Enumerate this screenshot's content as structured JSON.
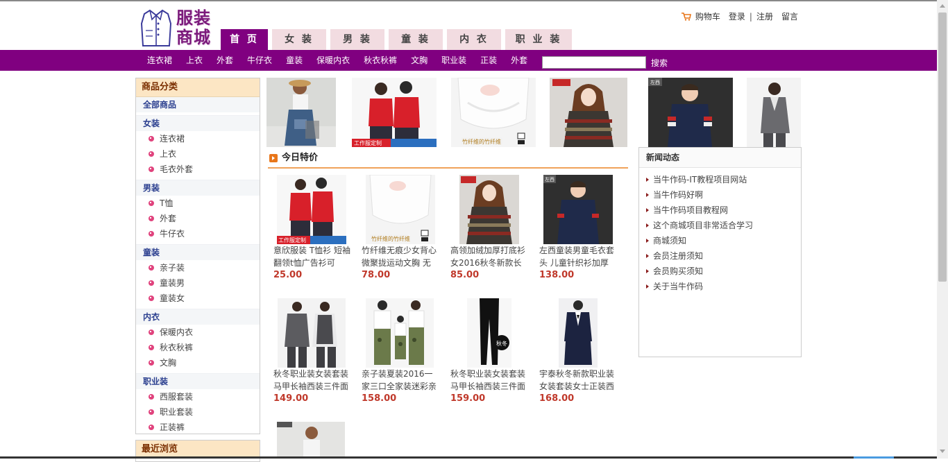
{
  "header": {
    "brand": "服装商城",
    "cart_label": "购物车",
    "links": [
      "登录",
      "注册",
      "留言"
    ],
    "separator": "|"
  },
  "nav_tabs": [
    {
      "label": "首 页",
      "active": true
    },
    {
      "label": "女 装",
      "active": false
    },
    {
      "label": "男 装",
      "active": false
    },
    {
      "label": "童 装",
      "active": false
    },
    {
      "label": "内 衣",
      "active": false
    },
    {
      "label": "职 业 装",
      "active": false
    }
  ],
  "category_bar": {
    "links": [
      "连衣裙",
      "上衣",
      "外套",
      "牛仔衣",
      "童装",
      "保暖内衣",
      "秋衣秋裤",
      "文胸",
      "职业装",
      "正装",
      "外套"
    ],
    "search_value": "",
    "search_button": "搜索"
  },
  "sidebar": {
    "title": "商品分类",
    "all_label": "全部商品",
    "groups": [
      {
        "name": "女装",
        "items": [
          "连衣裙",
          "上衣",
          "毛衣外套"
        ]
      },
      {
        "name": "男装",
        "items": [
          "T恤",
          "外套",
          "牛仔衣"
        ]
      },
      {
        "name": "童装",
        "items": [
          "亲子装",
          "童装男",
          "童装女"
        ]
      },
      {
        "name": "内衣",
        "items": [
          "保暖内衣",
          "秋衣秋裤",
          "文胸"
        ]
      },
      {
        "name": "职业装",
        "items": [
          "西服套装",
          "职业套装",
          "正装裤"
        ]
      }
    ],
    "recent_title": "最近浏览"
  },
  "banner_images": [
    "girl-denim-dress",
    "couple-red-polo",
    "white-sports-bra",
    "striped-sweater-woman",
    "boy-navy-sweater",
    "grey-business-suit"
  ],
  "special": {
    "title": "今日特价",
    "products": [
      {
        "name": "意欣服装 T恤衫 短袖翻领t恤广告衫可",
        "price": "25.00",
        "image": "couple-red-polo"
      },
      {
        "name": "竹纤维无痕少女背心 微聚拢运动文胸 无",
        "price": "78.00",
        "image": "white-sports-bra"
      },
      {
        "name": "高领加绒加厚打底衫女2016秋冬新款长",
        "price": "85.00",
        "image": "striped-sweater-woman"
      },
      {
        "name": "左西童装男童毛衣套头 儿童针织衫加厚",
        "price": "138.00",
        "image": "boy-navy-sweater"
      },
      {
        "name": "秋冬职业装女装套装马甲长袖西装三件面",
        "price": "149.00",
        "image": "grey-vest-suit"
      },
      {
        "name": "亲子装夏装2016一家三口全家装迷彩亲",
        "price": "158.00",
        "image": "family-camo"
      },
      {
        "name": "秋冬职业装女装套装马甲长袖西装三件面",
        "price": "159.00",
        "image": "black-trousers"
      },
      {
        "name": "宇泰秋冬新款职业装女装套装女士正装西",
        "price": "168.00",
        "image": "navy-skirt-suit"
      }
    ],
    "banner_tags": {
      "red_polo": "工作服定制",
      "bra": "竹纤维的竹纤维",
      "badge": "秋冬",
      "brand_tag": "左西"
    }
  },
  "news": {
    "title": "新闻动态",
    "items": [
      "当牛作码-IT教程项目网站",
      "当牛作码好啊",
      "当牛作码项目教程网",
      "这个商城项目非常适合学习",
      "商城须知",
      "会员注册须知",
      "会员购买须知",
      "关于当牛作码"
    ]
  },
  "colors": {
    "accent": "#800080",
    "price": "#c0392b",
    "tab_bg": "#f2dce1",
    "sidebar_head": "#fce6c4"
  }
}
